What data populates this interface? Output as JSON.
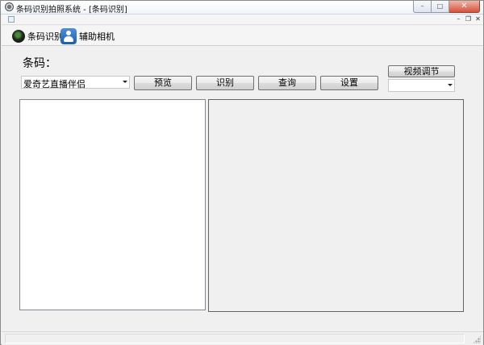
{
  "window": {
    "title": "条码识别拍照系统 - [条码识别]",
    "controls": {
      "minimize": "–",
      "maximize": "□",
      "close": "✕"
    }
  },
  "mdi": {
    "controls": {
      "minimize": "–",
      "restore": "❐",
      "close": "✕"
    }
  },
  "toolbar": {
    "items": [
      {
        "label": "条码识别",
        "icon": "scan-icon"
      },
      {
        "label": "辅助相机",
        "icon": "user-icon"
      }
    ]
  },
  "main": {
    "barcode_label": "条码：",
    "source_select": {
      "value": "爱奇艺直播伴侣"
    },
    "buttons": {
      "preview": "预览",
      "recognize": "识别",
      "query": "查询",
      "settings": "设置",
      "video_adjust": "视频调节"
    },
    "device_select": {
      "value": ""
    }
  }
}
